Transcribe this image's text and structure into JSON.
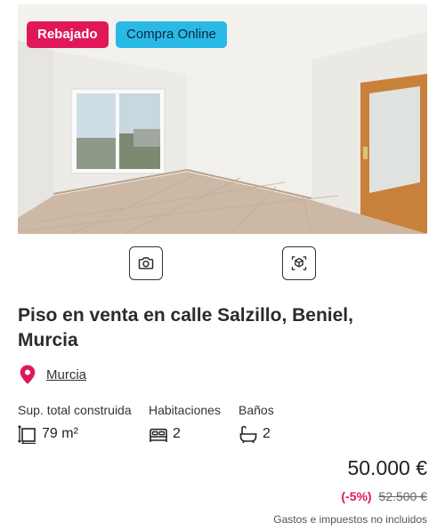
{
  "listing": {
    "badges": {
      "reduced": "Rebajado",
      "online": "Compra Online"
    },
    "media": {
      "photos_icon": "camera-icon",
      "tour_icon": "3d-cube-icon"
    },
    "title": "Piso en venta en calle Salzillo, Beniel, Murcia",
    "location": {
      "icon": "map-pin-icon",
      "link": "Murcia"
    },
    "features": [
      {
        "label": "Sup. total construida",
        "value": "79 m²",
        "icon": "area-icon"
      },
      {
        "label": "Habitaciones",
        "value": "2",
        "icon": "bed-icon"
      },
      {
        "label": "Baños",
        "value": "2",
        "icon": "bathtub-icon"
      }
    ],
    "price": {
      "current": "50.000 €",
      "discount": "(-5%)",
      "previous": "52.500 €",
      "note": "Gastos e impuestos no incluidos"
    },
    "colors": {
      "brand_pink": "#e0185a",
      "online_blue": "#2ab9e6"
    }
  }
}
